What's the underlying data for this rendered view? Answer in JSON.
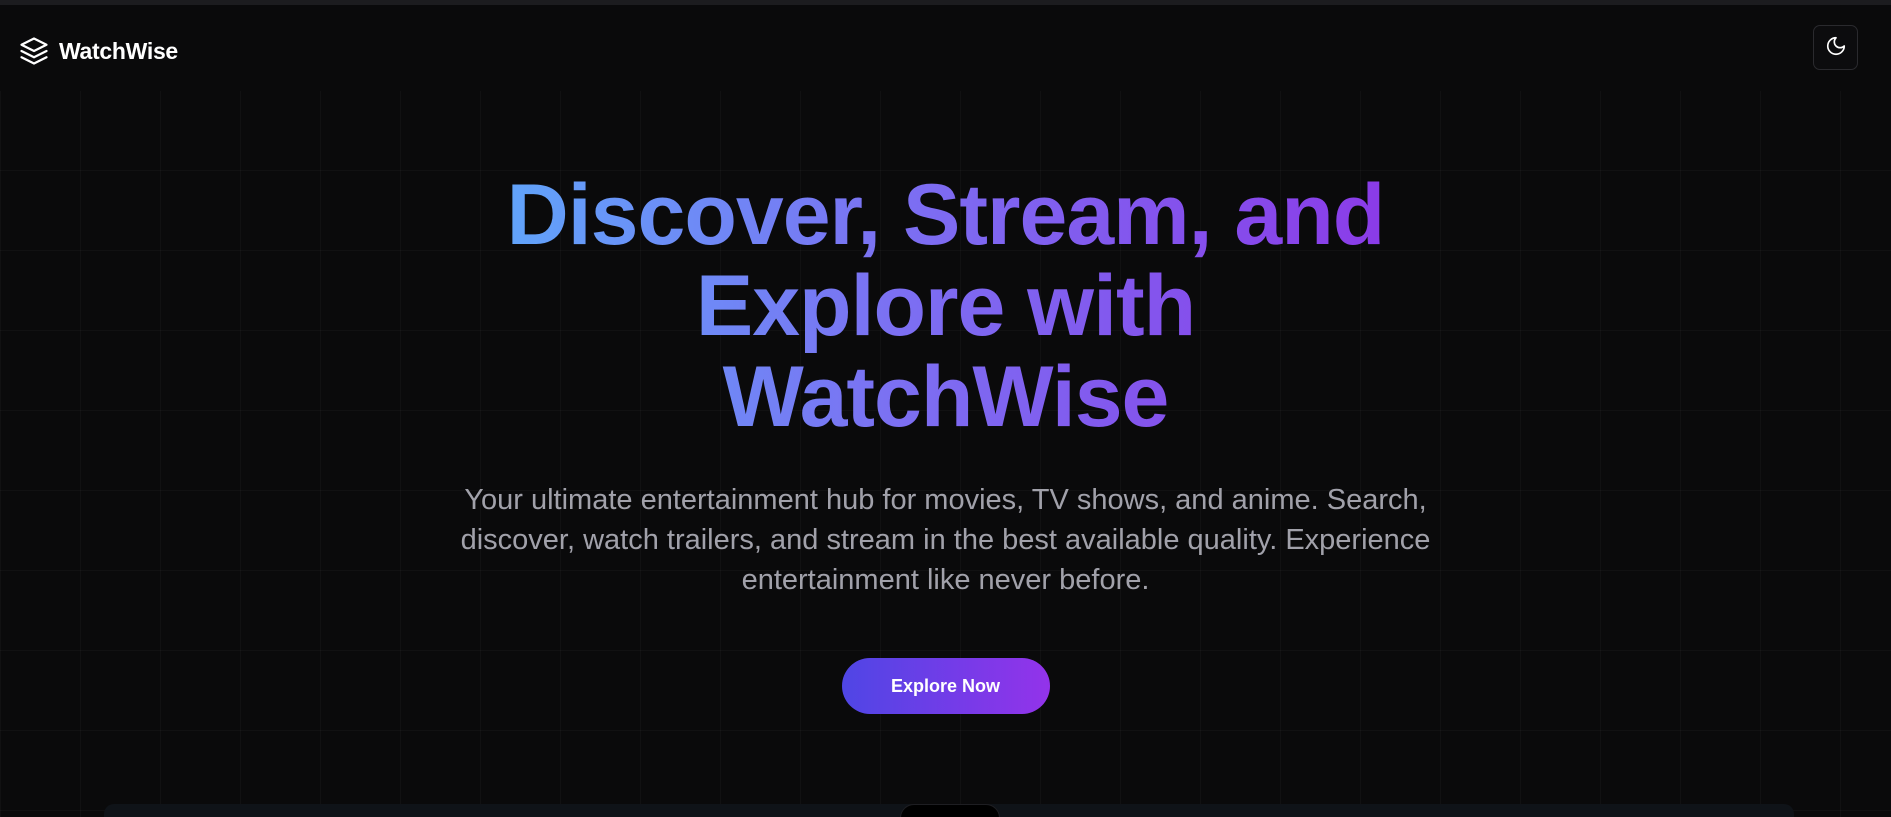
{
  "navbar": {
    "brand_name": "WatchWise",
    "brand_icon": "layers-icon",
    "theme_toggle_icon": "moon-icon"
  },
  "hero": {
    "title": "Discover, Stream, and Explore with WatchWise",
    "subtitle": "Your ultimate entertainment hub for movies, TV shows, and anime. Search, discover, watch trailers, and stream in the best available quality. Experience entertainment like never before.",
    "cta_label": "Explore Now"
  },
  "colors": {
    "background": "#0a0a0b",
    "title_gradient_start": "#60a5fa",
    "title_gradient_end": "#8b3ae8",
    "cta_gradient_start": "#4f46e5",
    "cta_gradient_end": "#9333ea",
    "subtitle": "#a1a1aa"
  }
}
